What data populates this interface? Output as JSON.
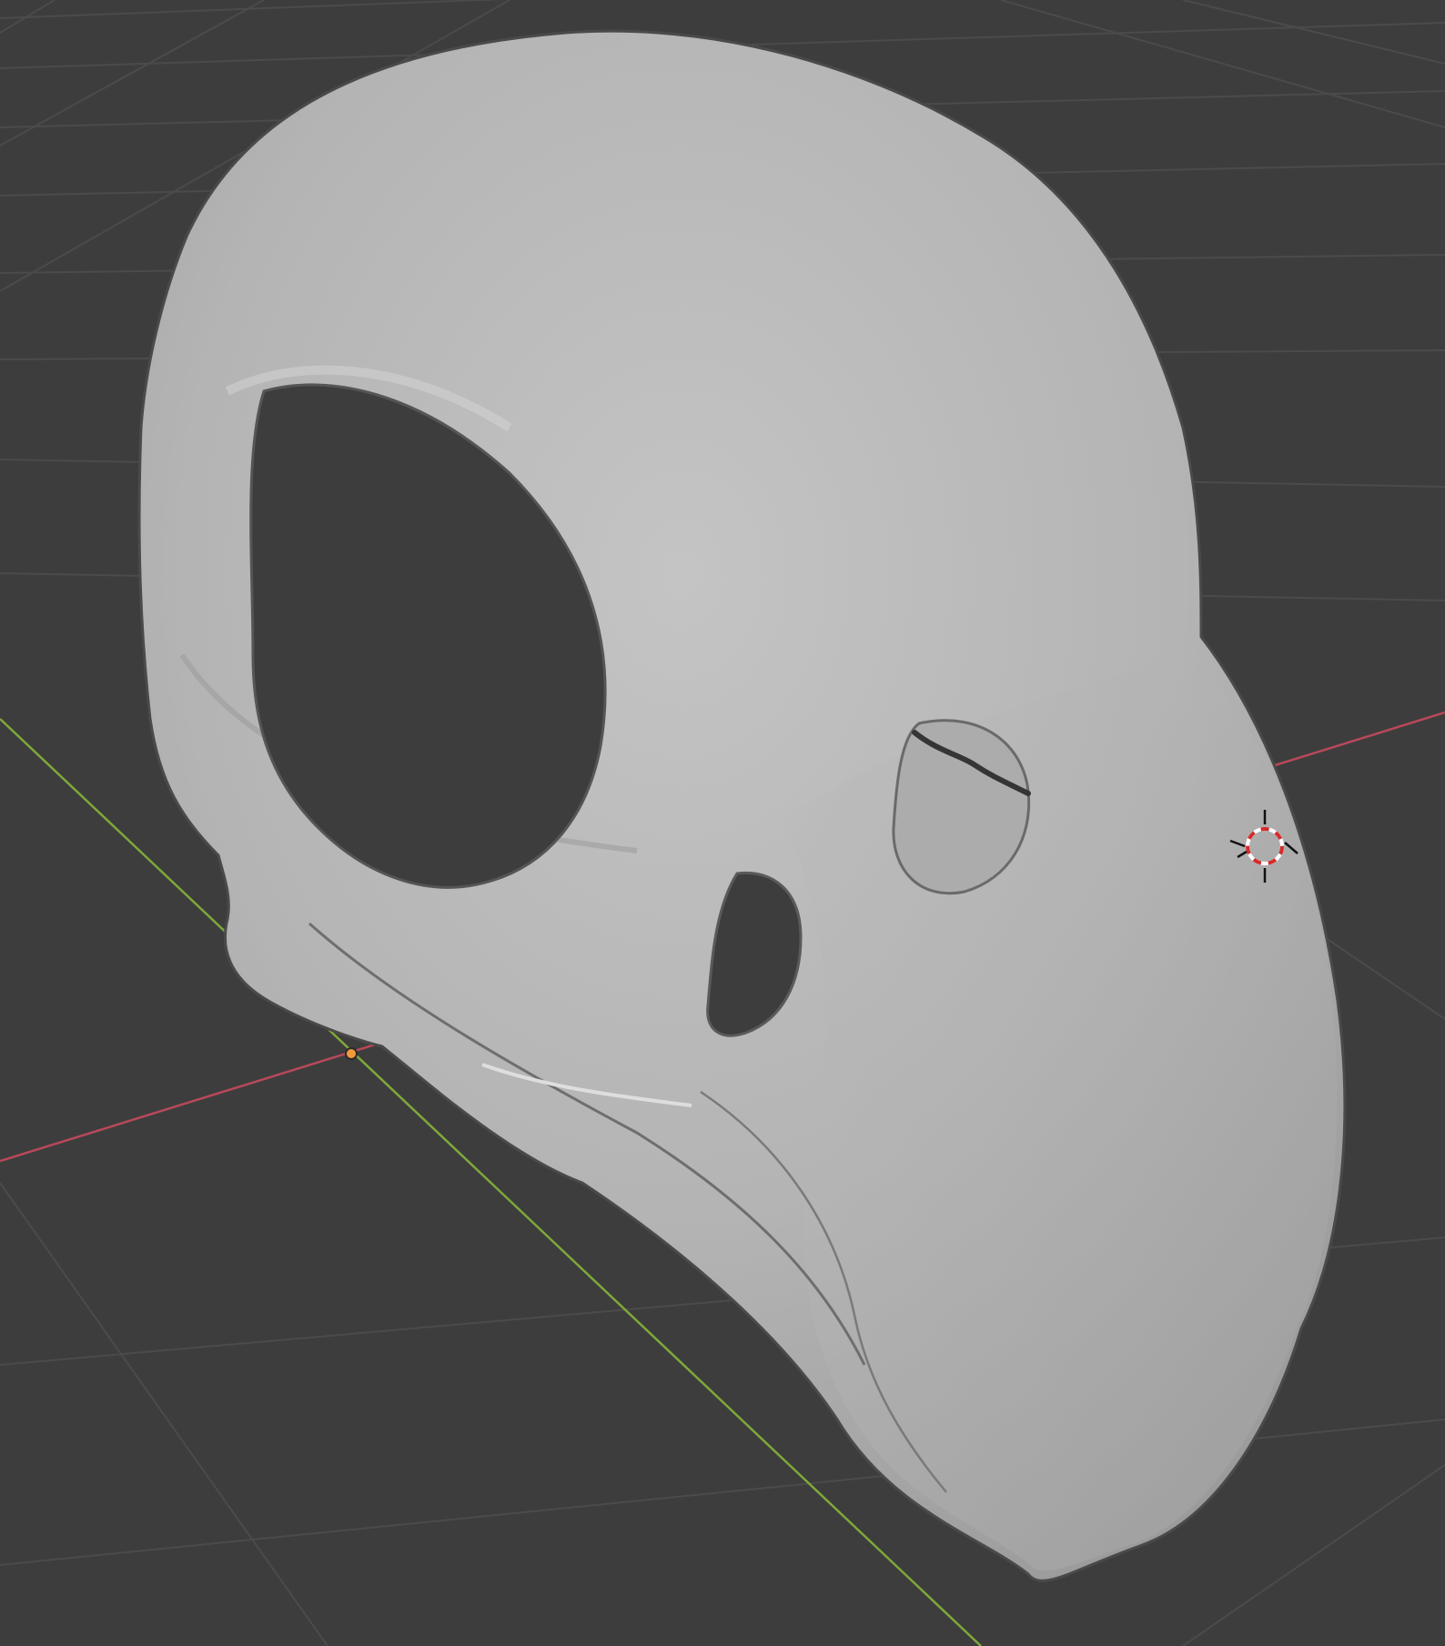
{
  "app": {
    "view": "3D Viewport",
    "shading": "solid"
  },
  "viewport": {
    "background_color": "#3d3d3d",
    "grid_color": "#4b4b4b",
    "x_axis_color": "#b8485a",
    "y_axis_color": "#7ea83a"
  },
  "mesh": {
    "kind": "bird skull",
    "base_color": "#b6b6b6",
    "shadow_color": "#8f8f8f",
    "highlight_color": "#cbcbcb"
  },
  "origin": {
    "color": "#f29a3a"
  },
  "cursor_3d": {
    "ring_colors": [
      "#d62b2b",
      "#ffffff"
    ]
  }
}
